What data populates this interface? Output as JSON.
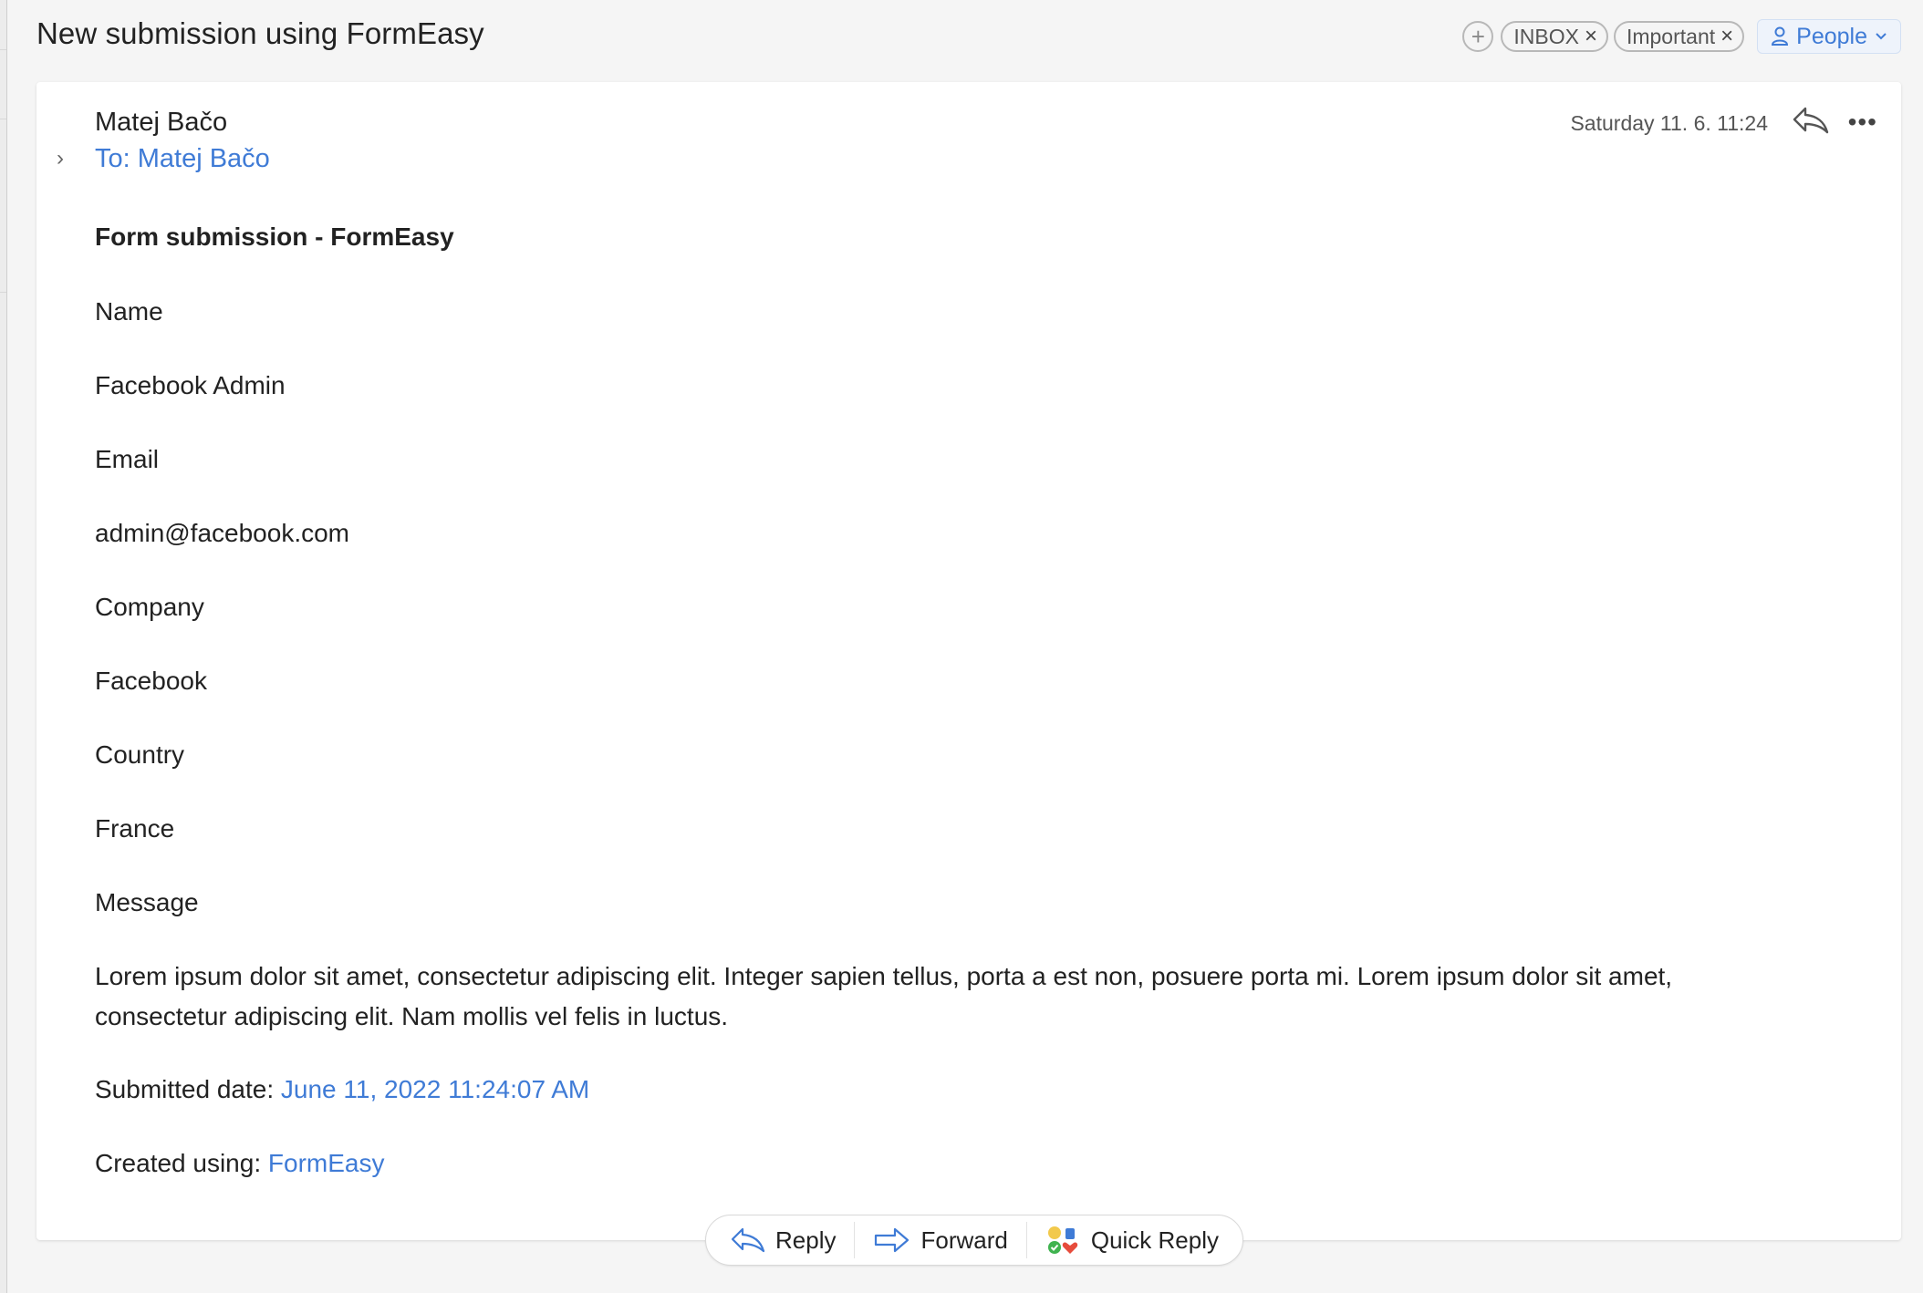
{
  "header": {
    "subject": "New submission using FormEasy",
    "add_tag_symbol": "+",
    "tags": [
      {
        "label": "INBOX",
        "remove_symbol": "×"
      },
      {
        "label": "Important",
        "remove_symbol": "×"
      }
    ],
    "people_label": "People"
  },
  "message": {
    "sender": "Matej Bačo",
    "to_line": "To: Matej Bačo",
    "date": "Saturday 11. 6. 11:24",
    "more_symbol": "•••",
    "expand_symbol": "›"
  },
  "body": {
    "heading": "Form submission - FormEasy",
    "name_label": "Name",
    "name_value": "Facebook Admin",
    "email_label": "Email",
    "email_value": "admin@facebook.com",
    "company_label": "Company",
    "company_value": "Facebook",
    "country_label": "Country",
    "country_value": "France",
    "message_label": "Message",
    "message_value": "Lorem ipsum dolor sit amet, consectetur adipiscing elit. Integer sapien tellus, porta a est non, posuere porta mi. Lorem ipsum dolor sit amet, consectetur adipiscing elit. Nam mollis vel felis in luctus.",
    "submitted_prefix": "Submitted date: ",
    "submitted_value": "June 11, 2022 11:24:07 AM",
    "created_prefix": "Created using: ",
    "created_value": "FormEasy"
  },
  "actions": {
    "reply_label": "Reply",
    "forward_label": "Forward",
    "quick_reply_label": "Quick Reply"
  },
  "colors": {
    "link": "#3f7bd6",
    "background": "#f5f5f5",
    "card": "#ffffff"
  },
  "icons": [
    "plus-icon",
    "close-icon",
    "person-icon",
    "chevron-down-icon",
    "chevron-right-icon",
    "reply-icon",
    "more-icon",
    "forward-icon",
    "quick-reply-icon"
  ]
}
